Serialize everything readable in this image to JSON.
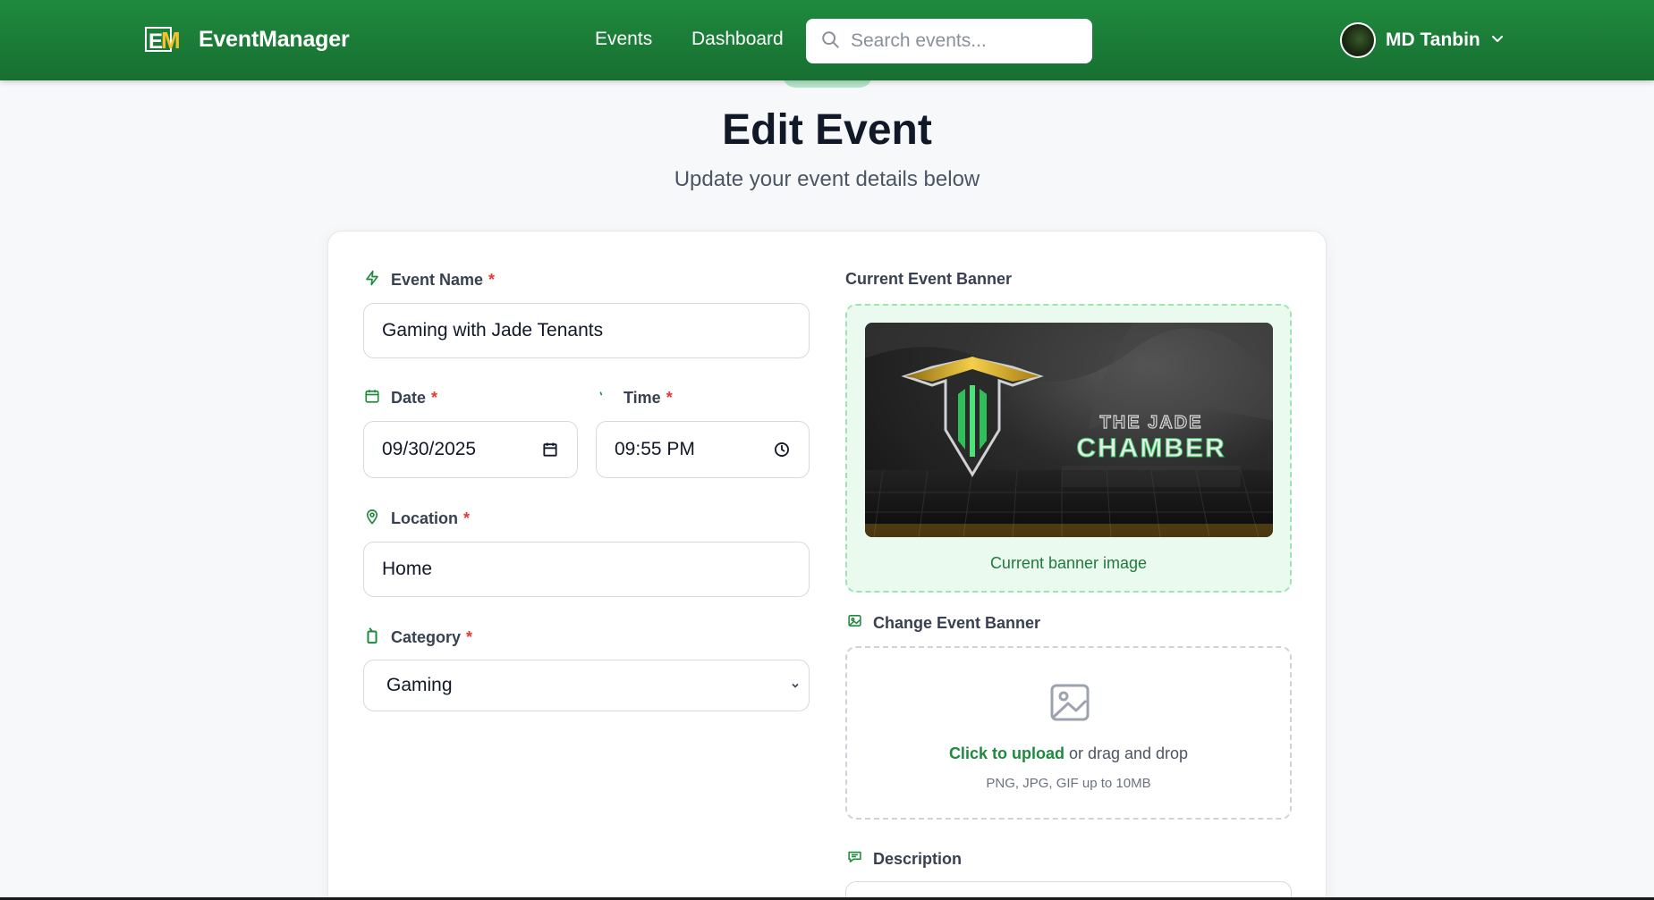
{
  "nav": {
    "brand": "EventManager",
    "links": [
      "Events",
      "Dashboard"
    ],
    "search_placeholder": "Search events...",
    "user_name": "MD Tanbin"
  },
  "page": {
    "title": "Edit Event",
    "subtitle": "Update your event details below"
  },
  "form": {
    "event_name": {
      "label": "Event Name",
      "required": "*",
      "value": "Gaming with Jade Tenants"
    },
    "date": {
      "label": "Date",
      "required": "*",
      "value": "09/30/2025"
    },
    "time": {
      "label": "Time",
      "required": "*",
      "value": "09:55 PM"
    },
    "location": {
      "label": "Location",
      "required": "*",
      "value": "Home"
    },
    "category": {
      "label": "Category",
      "required": "*",
      "value": "Gaming"
    },
    "current_banner": {
      "label": "Current Event Banner",
      "caption": "Current banner image",
      "image_text_line1": "THE JADE",
      "image_text_line2": "CHAMBER"
    },
    "change_banner": {
      "label": "Change Event Banner",
      "upload_link": "Click to upload",
      "upload_rest": " or drag and drop",
      "hint": "PNG, JPG, GIF up to 10MB"
    },
    "description": {
      "label": "Description"
    }
  },
  "colors": {
    "primary": "#1f8a3e",
    "required": "#e53935",
    "banner_bg": "#eafaef"
  }
}
